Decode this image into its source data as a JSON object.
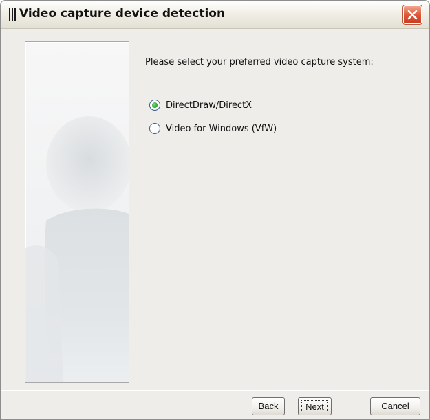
{
  "window": {
    "title": "Video capture device detection",
    "app_icon": "bars-icon",
    "close_icon": "close-icon"
  },
  "side_panel": {
    "image": "faded-person-silhouette-image"
  },
  "main": {
    "prompt": "Please select your preferred video capture system:",
    "options": [
      {
        "label": "DirectDraw/DirectX",
        "selected": true
      },
      {
        "label": "Video for Windows (VfW)",
        "selected": false
      }
    ]
  },
  "buttons": {
    "back": "Back",
    "next": "Next",
    "cancel": "Cancel"
  },
  "colors": {
    "radio_selected": "#33a833",
    "close_button": "#e0583a"
  }
}
